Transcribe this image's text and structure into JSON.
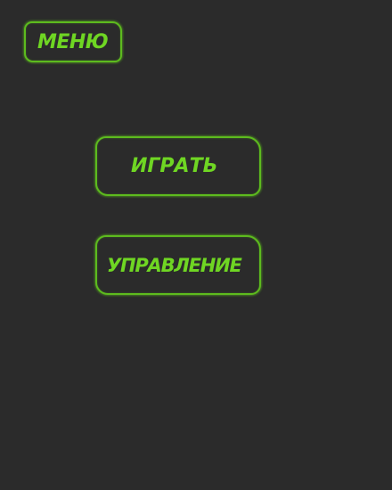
{
  "menu": {
    "label": "МЕНЮ"
  },
  "buttons": {
    "play_label": "ИГРАТЬ",
    "controls_label": "УПРАВЛЕНИЕ"
  },
  "colors": {
    "background": "#2b2b2b",
    "accent": "#6fd623",
    "border": "#5dbb1e"
  }
}
